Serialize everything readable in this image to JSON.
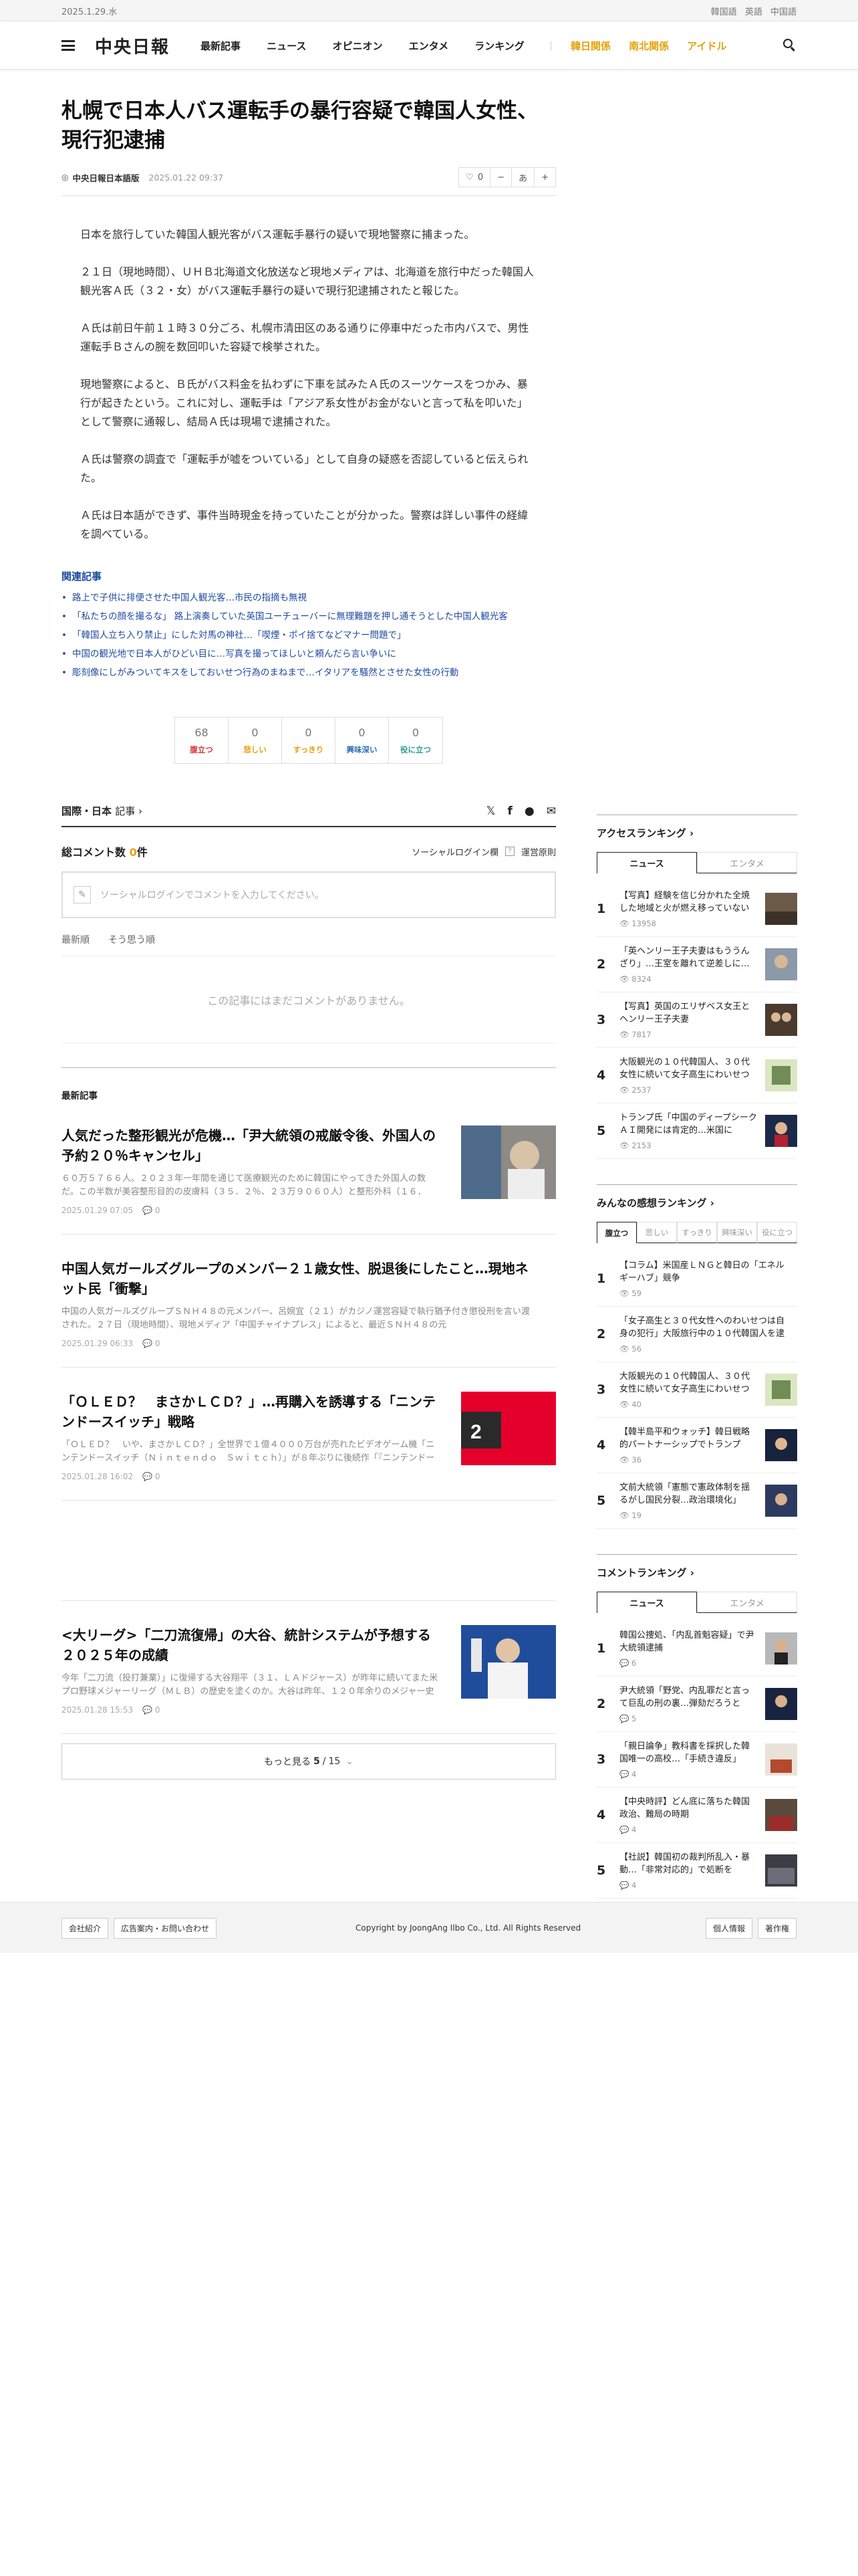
{
  "topbar": {
    "date": "2025.1.29.水",
    "languages": [
      "韓国語",
      "英語",
      "中国語"
    ]
  },
  "header": {
    "logo": "中央日報",
    "nav": [
      "最新記事",
      "ニュース",
      "オピニオン",
      "エンタメ",
      "ランキング"
    ],
    "nav_special": [
      "韓日関係",
      "南北関係",
      "アイドル"
    ]
  },
  "article": {
    "title": "札幌で日本人バス運転手の暴行容疑で韓国人女性、現行犯逮捕",
    "byline": "中央日報日本語版",
    "date": "2025.01.22 09:37",
    "like_count": "0",
    "font_label": "あ",
    "paragraphs": [
      "日本を旅行していた韓国人観光客がバス運転手暴行の疑いで現地警察に捕まった。",
      "２１日（現地時間）、ＵＨＢ北海道文化放送など現地メディアは、北海道を旅行中だった韓国人観光客Ａ氏（３２・女）がバス運転手暴行の疑いで現行犯逮捕されたと報じた。",
      "Ａ氏は前日午前１１時３０分ごろ、札幌市清田区のある通りに停車中だった市内バスで、男性運転手Ｂさんの腕を数回叩いた容疑で検挙された。",
      "現地警察によると、Ｂ氏がバス料金を払わずに下車を試みたＡ氏のスーツケースをつかみ、暴行が起きたという。これに対し、運転手は「アジア系女性がお金がないと言って私を叩いた」として警察に通報し、結局Ａ氏は現場で逮捕された。",
      "Ａ氏は警察の調査で「運転手が嘘をついている」として自身の疑惑を否認していると伝えられた。",
      "Ａ氏は日本語ができず、事件当時現金を持っていたことが分かった。警察は詳しい事件の経緯を調べている。"
    ],
    "related_title": "関連記事",
    "related": [
      "路上で子供に排便させた中国人観光客…市民の指摘も無視",
      "「私たちの顔を撮るな」 路上演奏していた英国ユーチューバーに無理難題を押し通そうとした中国人観光客",
      "「韓国人立ち入り禁止」にした対馬の神社…「喫煙・ポイ捨てなどマナー問題で」",
      "中国の観光地で日本人がひどい目に…写真を撮ってほしいと頼んだら言い争いに",
      "彫刻像にしがみついてキスをしておいせつ行為のまねまで…イタリアを騒然とさせた女性の行動"
    ]
  },
  "reactions": [
    {
      "count": "68",
      "label": "腹立つ",
      "color": "#d9373a"
    },
    {
      "count": "0",
      "label": "悲しい",
      "color": "#e3a30b"
    },
    {
      "count": "0",
      "label": "すっきり",
      "color": "#e3a30b"
    },
    {
      "count": "0",
      "label": "興味深い",
      "color": "#2f6fb3"
    },
    {
      "count": "0",
      "label": "役に立つ",
      "color": "#2a9d8f"
    }
  ],
  "section_bar": {
    "name": "国際・日本",
    "suffix": "記事 ›"
  },
  "comments": {
    "title": "総コメント数",
    "count": "0",
    "count_unit": "件",
    "social_login": "ソーシャルログイン欄",
    "policy": "運営原則",
    "placeholder": "ソーシャルログインでコメントを入力してください。",
    "sort": [
      "最新順",
      "そう思う順"
    ],
    "empty": "この記事にはまだコメントがありません。"
  },
  "latest": {
    "label": "最新記事",
    "items": [
      {
        "headline": "人気だった整形観光が危機…「尹大統領の戒厳令後、外国人の予約２０％キャンセル」",
        "summary": "６０万５７６６人。２０２３年一年間を通じて医療観光のために韓国にやってきた外国人の数だ。この半数が美容整形目的の皮膚科（３５．２％、２３万９０６０人）と整形外科（１６．",
        "date": "2025.01.29 07:05",
        "comments": "0"
      },
      {
        "headline": "中国人気ガールズグループのメンバー２１歳女性、脱退後にしたこと…現地ネット民「衝撃」",
        "summary": "中国の人気ガールズグループＳＮＨ４８の元メンバー、呂婉宜（２１）がカジノ運営容疑で執行猶予付き懲役刑を言い渡された。２７日（現地時間）、現地メディア「中国チャイナプレス」によると、最近ＳＮＨ４８の元",
        "date": "2025.01.29 06:33",
        "comments": "0"
      },
      {
        "headline": "「ＯＬＥＤ？　まさかＬＣＤ？」…再購入を誘導する「ニンテンドースイッチ」戦略",
        "summary": "「ＯＬＥＤ？　いや、まさかＬＣＤ？」全世界で１億４０００万台が売れたビデオゲーム機「ニンテンドースイッチ（Ｎｉｎｔｅｎｄｏ　Ｓｗｉｔｃｈ）」が８年ぶりに後続作「『ニンテンドー",
        "date": "2025.01.28 16:02",
        "comments": "0"
      },
      {
        "headline": "<大リーグ>「二刀流復帰」の大谷、統計システムが予想する２０２５年の成績",
        "summary": "今年「二刀流（投打兼業）」に復帰する大谷翔平（３１、ＬＡドジャース）が昨年に続いてまた米プロ野球メジャーリーグ（ＭＬＢ）の歴史を塗くのか。大谷は昨年、１２０年余りのメジャー史",
        "date": "2025.01.28 15:53",
        "comments": "0"
      }
    ],
    "more_label": "もっと見る",
    "page_current": "5",
    "page_total": "15"
  },
  "sidebar": {
    "access": {
      "title": "アクセスランキング ›",
      "tabs": [
        "ニュース",
        "エンタメ"
      ],
      "items": [
        {
          "title": "【写真】経験を信じ分かれた全焼した地域と火が燃え移っていない地域",
          "views": "13958"
        },
        {
          "title": "「英ヘンリー王子夫妻はもううんざり」…王室を離れて逆差しに…",
          "views": "8324"
        },
        {
          "title": "【写真】英国のエリザベス女王とヘンリー王子夫妻",
          "views": "7817"
        },
        {
          "title": "大阪観光の１０代韓国人、３０代女性に続いて女子高生にわいせつ",
          "views": "2537"
        },
        {
          "title": "トランプ氏「中国のディープシークＡＩ開発には肯定的…米国に",
          "views": "2153"
        }
      ]
    },
    "emotion": {
      "title": "みんなの感想ランキング ›",
      "tabs": [
        "腹立つ",
        "悲しい",
        "すっきり",
        "興味深い",
        "役に立つ"
      ],
      "items": [
        {
          "title": "【コラム】米国産ＬＮＧと韓日の「エネルギーハブ」競争",
          "views": "59"
        },
        {
          "title": "「女子高生と３０代女性へのわいせつは自身の犯行」大阪旅行中の１０代韓国人を逮捕",
          "views": "56"
        },
        {
          "title": "大阪観光の１０代韓国人、３０代女性に続いて女子高生にわいせつ",
          "views": "40"
        },
        {
          "title": "【韓半島平和ウォッチ】韓日戦略的パートナーシップでトランプ",
          "views": "36"
        },
        {
          "title": "文前大統領「憲態で憲政体制を揺るがし国民分裂…政治環境化」",
          "views": "19"
        }
      ]
    },
    "comment": {
      "title": "コメントランキング ›",
      "tabs": [
        "ニュース",
        "エンタメ"
      ],
      "items": [
        {
          "title": "韓国公捜処、「内乱首魁容疑」で尹大統領逮捕",
          "views": "6"
        },
        {
          "title": "尹大統領「野党、内乱罪だと言って巨乱の刑の裏…弾劾だろうと",
          "views": "5"
        },
        {
          "title": "「親日論争」教科書を採択した韓国唯一の高校…「手続き違反」",
          "views": "4"
        },
        {
          "title": "【中央時評】どん底に落ちた韓国政治、難局の時期",
          "views": "4"
        },
        {
          "title": "【社説】韓国初の裁判所乱入・暴動…「非常対応的」で処断を",
          "views": "4"
        }
      ]
    }
  },
  "footer": {
    "links": [
      "会社紹介",
      "広告案内・お問い合わせ"
    ],
    "copyright": "Copyright by JoongAng Ilbo Co., Ltd. All Rights Reserved",
    "right_links": [
      "個人情報",
      "著作権"
    ]
  }
}
